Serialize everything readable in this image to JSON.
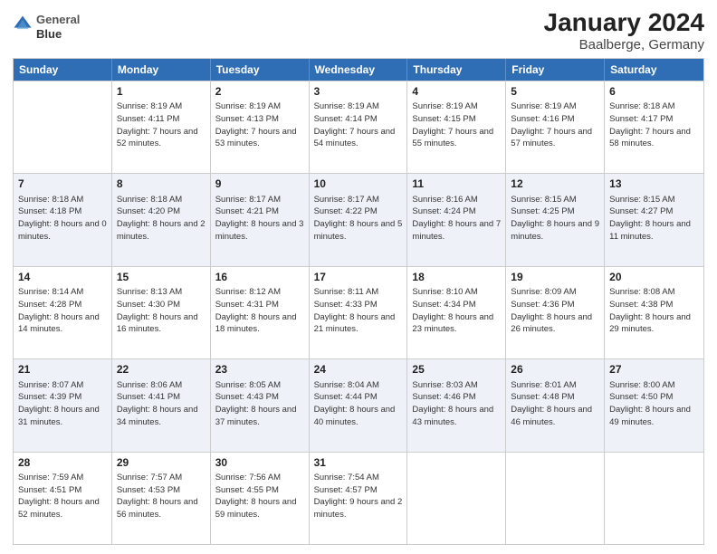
{
  "header": {
    "title": "January 2024",
    "subtitle": "Baalberge, Germany",
    "logo_line1": "General",
    "logo_line2": "Blue"
  },
  "days_of_week": [
    "Sunday",
    "Monday",
    "Tuesday",
    "Wednesday",
    "Thursday",
    "Friday",
    "Saturday"
  ],
  "weeks": [
    [
      {
        "day": "",
        "sunrise": "",
        "sunset": "",
        "daylight": "",
        "empty": true
      },
      {
        "day": "1",
        "sunrise": "Sunrise: 8:19 AM",
        "sunset": "Sunset: 4:11 PM",
        "daylight": "Daylight: 7 hours and 52 minutes."
      },
      {
        "day": "2",
        "sunrise": "Sunrise: 8:19 AM",
        "sunset": "Sunset: 4:13 PM",
        "daylight": "Daylight: 7 hours and 53 minutes."
      },
      {
        "day": "3",
        "sunrise": "Sunrise: 8:19 AM",
        "sunset": "Sunset: 4:14 PM",
        "daylight": "Daylight: 7 hours and 54 minutes."
      },
      {
        "day": "4",
        "sunrise": "Sunrise: 8:19 AM",
        "sunset": "Sunset: 4:15 PM",
        "daylight": "Daylight: 7 hours and 55 minutes."
      },
      {
        "day": "5",
        "sunrise": "Sunrise: 8:19 AM",
        "sunset": "Sunset: 4:16 PM",
        "daylight": "Daylight: 7 hours and 57 minutes."
      },
      {
        "day": "6",
        "sunrise": "Sunrise: 8:18 AM",
        "sunset": "Sunset: 4:17 PM",
        "daylight": "Daylight: 7 hours and 58 minutes."
      }
    ],
    [
      {
        "day": "7",
        "sunrise": "Sunrise: 8:18 AM",
        "sunset": "Sunset: 4:18 PM",
        "daylight": "Daylight: 8 hours and 0 minutes."
      },
      {
        "day": "8",
        "sunrise": "Sunrise: 8:18 AM",
        "sunset": "Sunset: 4:20 PM",
        "daylight": "Daylight: 8 hours and 2 minutes."
      },
      {
        "day": "9",
        "sunrise": "Sunrise: 8:17 AM",
        "sunset": "Sunset: 4:21 PM",
        "daylight": "Daylight: 8 hours and 3 minutes."
      },
      {
        "day": "10",
        "sunrise": "Sunrise: 8:17 AM",
        "sunset": "Sunset: 4:22 PM",
        "daylight": "Daylight: 8 hours and 5 minutes."
      },
      {
        "day": "11",
        "sunrise": "Sunrise: 8:16 AM",
        "sunset": "Sunset: 4:24 PM",
        "daylight": "Daylight: 8 hours and 7 minutes."
      },
      {
        "day": "12",
        "sunrise": "Sunrise: 8:15 AM",
        "sunset": "Sunset: 4:25 PM",
        "daylight": "Daylight: 8 hours and 9 minutes."
      },
      {
        "day": "13",
        "sunrise": "Sunrise: 8:15 AM",
        "sunset": "Sunset: 4:27 PM",
        "daylight": "Daylight: 8 hours and 11 minutes."
      }
    ],
    [
      {
        "day": "14",
        "sunrise": "Sunrise: 8:14 AM",
        "sunset": "Sunset: 4:28 PM",
        "daylight": "Daylight: 8 hours and 14 minutes."
      },
      {
        "day": "15",
        "sunrise": "Sunrise: 8:13 AM",
        "sunset": "Sunset: 4:30 PM",
        "daylight": "Daylight: 8 hours and 16 minutes."
      },
      {
        "day": "16",
        "sunrise": "Sunrise: 8:12 AM",
        "sunset": "Sunset: 4:31 PM",
        "daylight": "Daylight: 8 hours and 18 minutes."
      },
      {
        "day": "17",
        "sunrise": "Sunrise: 8:11 AM",
        "sunset": "Sunset: 4:33 PM",
        "daylight": "Daylight: 8 hours and 21 minutes."
      },
      {
        "day": "18",
        "sunrise": "Sunrise: 8:10 AM",
        "sunset": "Sunset: 4:34 PM",
        "daylight": "Daylight: 8 hours and 23 minutes."
      },
      {
        "day": "19",
        "sunrise": "Sunrise: 8:09 AM",
        "sunset": "Sunset: 4:36 PM",
        "daylight": "Daylight: 8 hours and 26 minutes."
      },
      {
        "day": "20",
        "sunrise": "Sunrise: 8:08 AM",
        "sunset": "Sunset: 4:38 PM",
        "daylight": "Daylight: 8 hours and 29 minutes."
      }
    ],
    [
      {
        "day": "21",
        "sunrise": "Sunrise: 8:07 AM",
        "sunset": "Sunset: 4:39 PM",
        "daylight": "Daylight: 8 hours and 31 minutes."
      },
      {
        "day": "22",
        "sunrise": "Sunrise: 8:06 AM",
        "sunset": "Sunset: 4:41 PM",
        "daylight": "Daylight: 8 hours and 34 minutes."
      },
      {
        "day": "23",
        "sunrise": "Sunrise: 8:05 AM",
        "sunset": "Sunset: 4:43 PM",
        "daylight": "Daylight: 8 hours and 37 minutes."
      },
      {
        "day": "24",
        "sunrise": "Sunrise: 8:04 AM",
        "sunset": "Sunset: 4:44 PM",
        "daylight": "Daylight: 8 hours and 40 minutes."
      },
      {
        "day": "25",
        "sunrise": "Sunrise: 8:03 AM",
        "sunset": "Sunset: 4:46 PM",
        "daylight": "Daylight: 8 hours and 43 minutes."
      },
      {
        "day": "26",
        "sunrise": "Sunrise: 8:01 AM",
        "sunset": "Sunset: 4:48 PM",
        "daylight": "Daylight: 8 hours and 46 minutes."
      },
      {
        "day": "27",
        "sunrise": "Sunrise: 8:00 AM",
        "sunset": "Sunset: 4:50 PM",
        "daylight": "Daylight: 8 hours and 49 minutes."
      }
    ],
    [
      {
        "day": "28",
        "sunrise": "Sunrise: 7:59 AM",
        "sunset": "Sunset: 4:51 PM",
        "daylight": "Daylight: 8 hours and 52 minutes."
      },
      {
        "day": "29",
        "sunrise": "Sunrise: 7:57 AM",
        "sunset": "Sunset: 4:53 PM",
        "daylight": "Daylight: 8 hours and 56 minutes."
      },
      {
        "day": "30",
        "sunrise": "Sunrise: 7:56 AM",
        "sunset": "Sunset: 4:55 PM",
        "daylight": "Daylight: 8 hours and 59 minutes."
      },
      {
        "day": "31",
        "sunrise": "Sunrise: 7:54 AM",
        "sunset": "Sunset: 4:57 PM",
        "daylight": "Daylight: 9 hours and 2 minutes."
      },
      {
        "day": "",
        "sunrise": "",
        "sunset": "",
        "daylight": "",
        "empty": true
      },
      {
        "day": "",
        "sunrise": "",
        "sunset": "",
        "daylight": "",
        "empty": true
      },
      {
        "day": "",
        "sunrise": "",
        "sunset": "",
        "daylight": "",
        "empty": true
      }
    ]
  ]
}
